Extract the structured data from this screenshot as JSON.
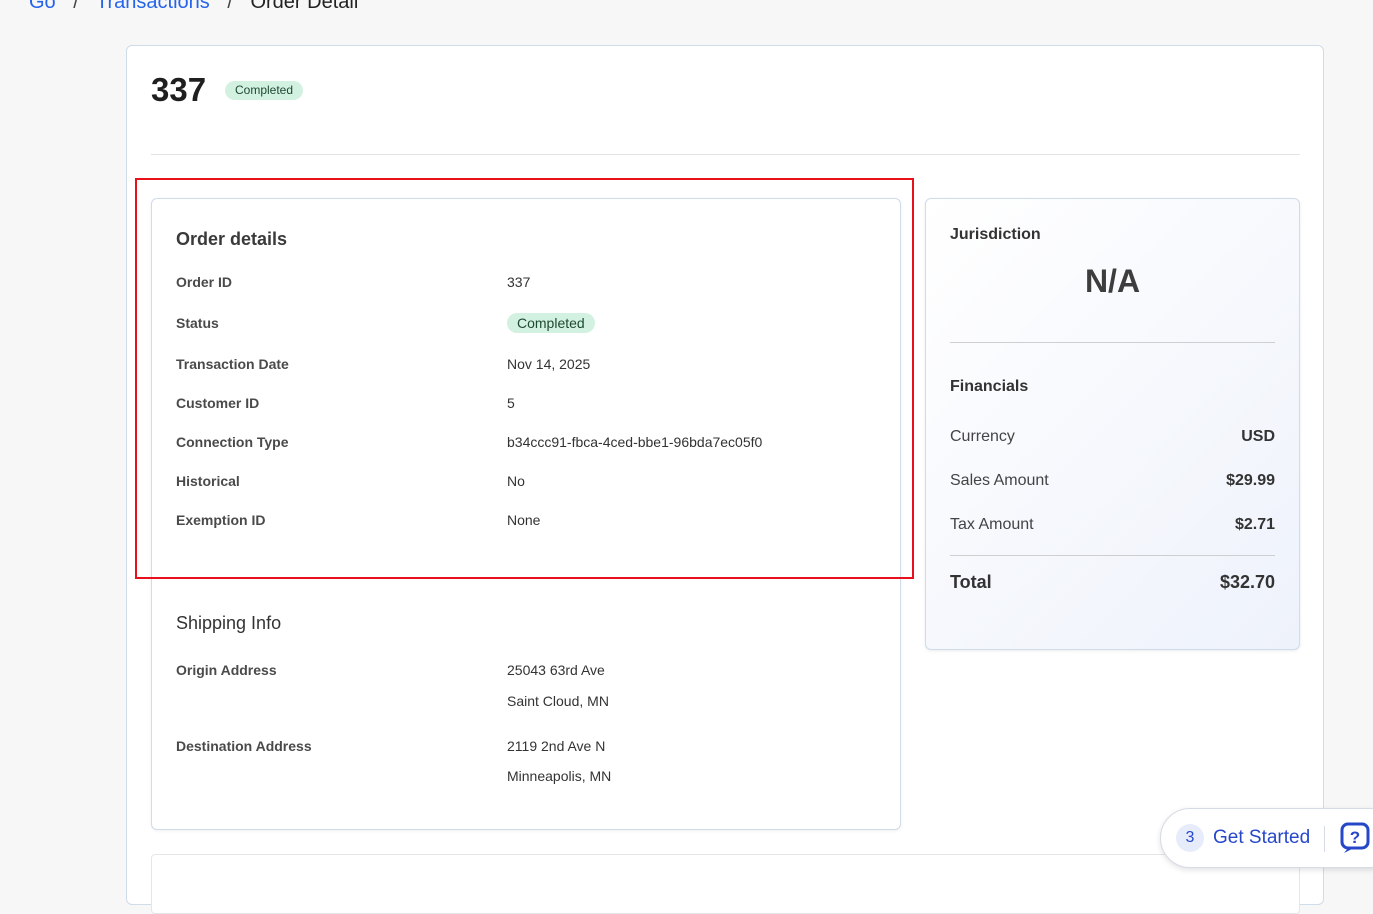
{
  "breadcrumb": {
    "items": [
      "Go",
      "Transactions"
    ],
    "current": "Order Detail"
  },
  "header": {
    "order_number": "337",
    "status_badge": "Completed"
  },
  "order_details": {
    "title": "Order details",
    "fields": [
      {
        "label": "Order ID",
        "value": "337"
      },
      {
        "label": "Status",
        "value": "Completed"
      },
      {
        "label": "Transaction Date",
        "value": "Nov 14, 2025"
      },
      {
        "label": "Customer ID",
        "value": "5"
      },
      {
        "label": "Connection Type",
        "value": "b34ccc91-fbca-4ced-bbe1-96bda7ec05f0"
      },
      {
        "label": "Historical",
        "value": "No"
      },
      {
        "label": "Exemption ID",
        "value": "None"
      }
    ]
  },
  "shipping_info": {
    "title": "Shipping Info",
    "origin": {
      "label": "Origin Address",
      "line1": "25043 63rd Ave",
      "line2": "Saint Cloud, MN"
    },
    "destination": {
      "label": "Destination Address",
      "line1": "2119 2nd Ave N",
      "line2": "Minneapolis, MN"
    }
  },
  "jurisdiction": {
    "label": "Jurisdiction",
    "value": "N/A"
  },
  "financials": {
    "title": "Financials",
    "rows": [
      {
        "label": "Currency",
        "value": "USD"
      },
      {
        "label": "Sales Amount",
        "value": "$29.99"
      },
      {
        "label": "Tax Amount",
        "value": "$2.71"
      }
    ],
    "total": {
      "label": "Total",
      "value": "$32.70"
    }
  },
  "get_started": {
    "count": "3",
    "label": "Get Started"
  },
  "colors": {
    "accent": "#2563eb",
    "badge_bg": "#d3f1e1",
    "highlight": "#e8101a"
  }
}
